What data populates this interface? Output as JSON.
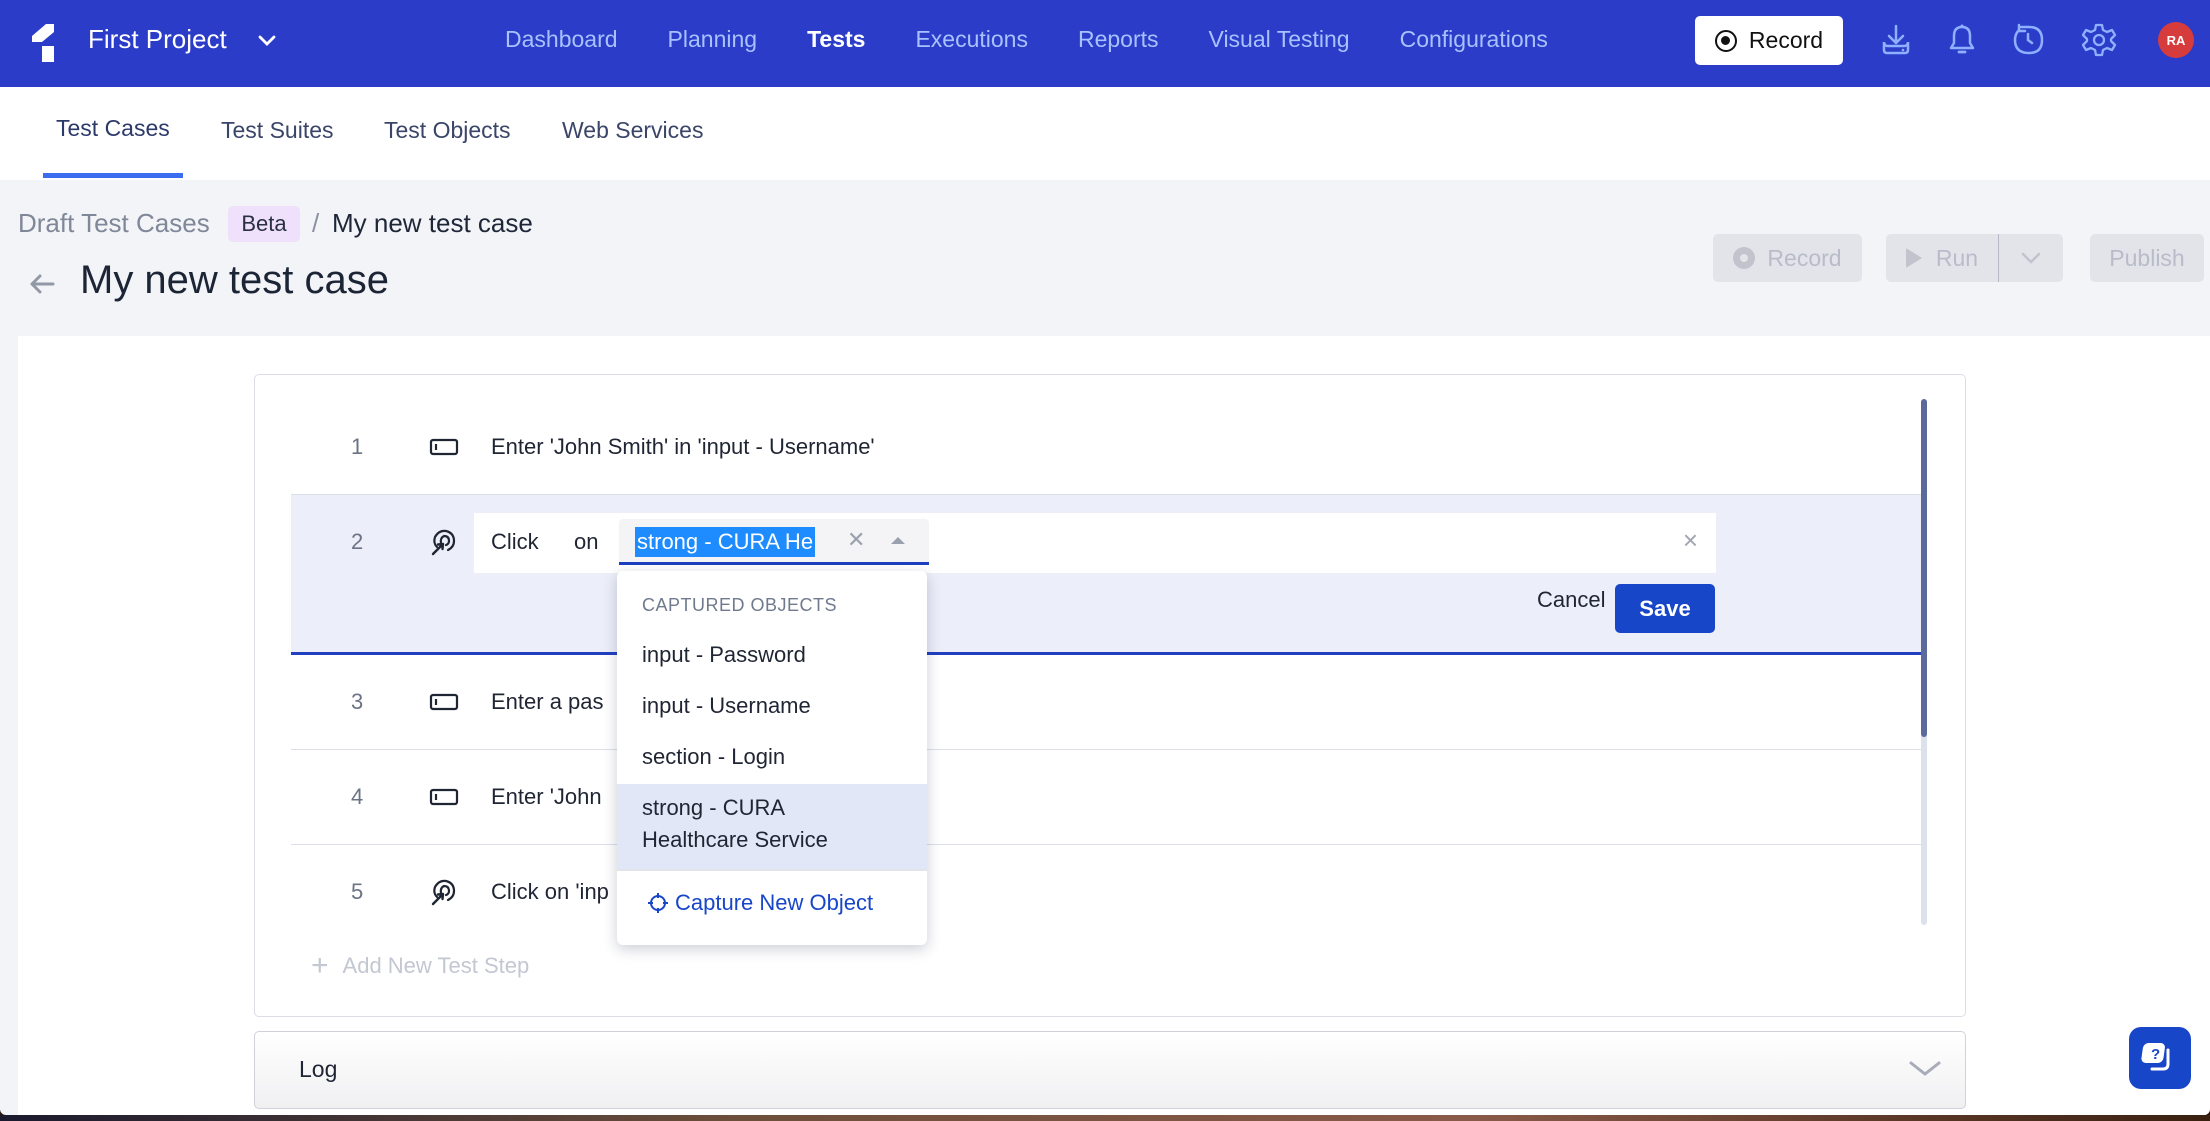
{
  "topnav": {
    "project_name": "First Project",
    "links": [
      "Dashboard",
      "Planning",
      "Tests",
      "Executions",
      "Reports",
      "Visual Testing",
      "Configurations"
    ],
    "active_link": "Tests",
    "record_label": "Record",
    "avatar_initials": "RA",
    "icons": [
      "download-icon",
      "bell-icon",
      "history-icon",
      "gear-icon"
    ]
  },
  "subtabs": {
    "items": [
      "Test Cases",
      "Test Suites",
      "Test Objects",
      "Web Services"
    ],
    "active": "Test Cases"
  },
  "breadcrumb": {
    "root": "Draft Test Cases",
    "badge": "Beta",
    "separator": "/",
    "current": "My new test case"
  },
  "header": {
    "title": "My new test case",
    "record_label": "Record",
    "run_label": "Run",
    "publish_label": "Publish"
  },
  "steps": [
    {
      "num": "1",
      "icon": "input-icon",
      "text": "Enter 'John Smith' in 'input - Username'"
    },
    {
      "num": "2",
      "icon": "click-icon",
      "action": "Click",
      "preposition": "on",
      "selected_object": "strong - CURA He",
      "cancel_label": "Cancel",
      "save_label": "Save"
    },
    {
      "num": "3",
      "icon": "input-icon",
      "text": "Enter a pas"
    },
    {
      "num": "4",
      "icon": "input-icon",
      "text": "Enter 'John"
    },
    {
      "num": "5",
      "icon": "click-icon",
      "text": "Click on 'inp"
    }
  ],
  "add_step_label": "Add New Test Step",
  "dropdown": {
    "header": "CAPTURED OBJECTS",
    "items": [
      "input - Password",
      "input - Username",
      "section - Login",
      "strong - CURA Healthcare Service"
    ],
    "highlighted": "strong - CURA Healthcare Service",
    "capture_label": "Capture New Object"
  },
  "log": {
    "label": "Log"
  },
  "colors": {
    "nav_bg": "#2b3cc8",
    "accent": "#1846c8",
    "avatar": "#d63c3c",
    "beta_badge": "#efe1fb"
  }
}
